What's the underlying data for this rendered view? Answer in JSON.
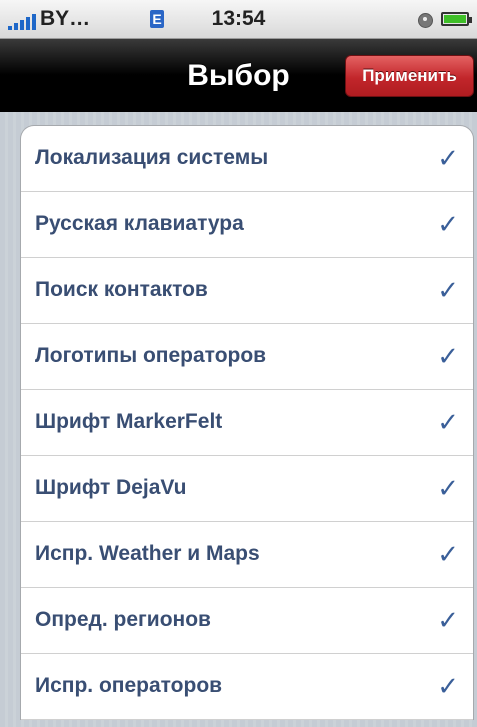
{
  "status_bar": {
    "carrier": "BY…",
    "network": "E",
    "time": "13:54"
  },
  "nav": {
    "title": "Выбор",
    "apply_label": "Применить"
  },
  "check_glyph": "✓",
  "items": [
    {
      "label": "Локализация системы"
    },
    {
      "label": "Русская клавиатура"
    },
    {
      "label": "Поиск контактов"
    },
    {
      "label": "Логотипы операторов"
    },
    {
      "label": "Шрифт MarkerFelt"
    },
    {
      "label": "Шрифт DejaVu"
    },
    {
      "label": "Испр. Weather и Maps"
    },
    {
      "label": "Опред. регионов"
    },
    {
      "label": "Испр. операторов"
    }
  ],
  "colors": {
    "label": "#394e73",
    "check": "#3a5f99",
    "apply_button": "#c2262b"
  }
}
